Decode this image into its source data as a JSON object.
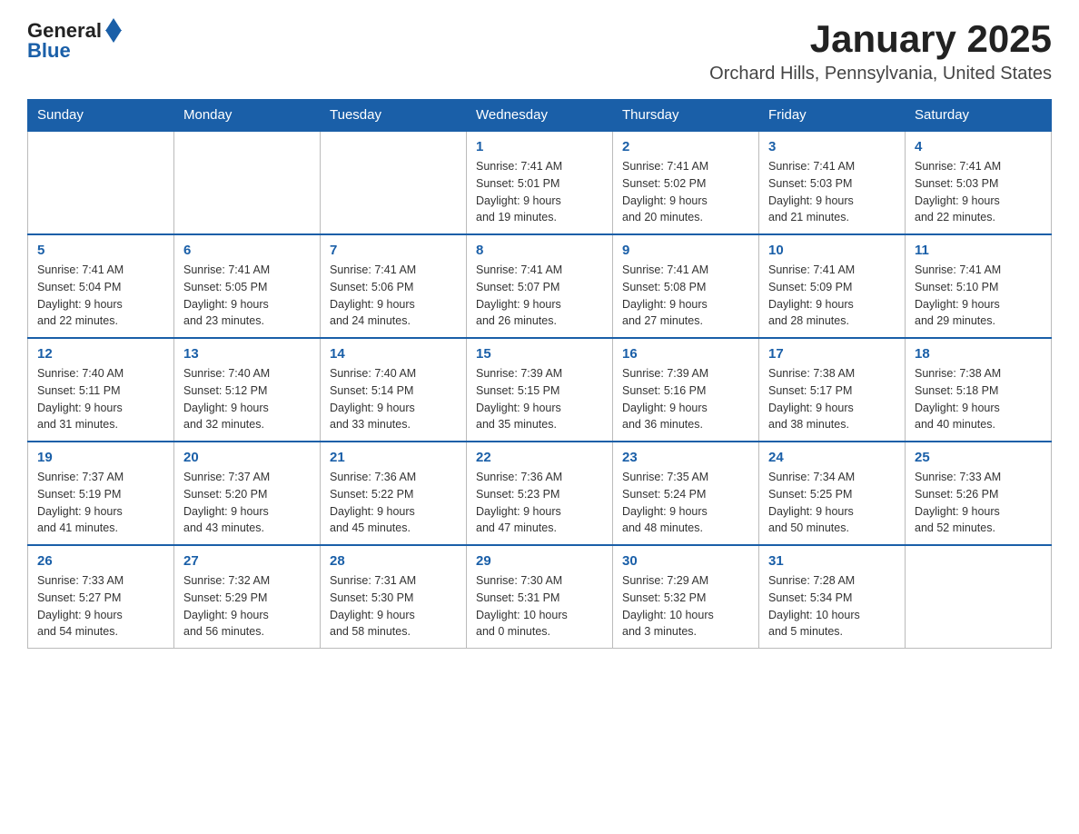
{
  "header": {
    "logo_general": "General",
    "logo_blue": "Blue",
    "month_title": "January 2025",
    "location": "Orchard Hills, Pennsylvania, United States"
  },
  "days_of_week": [
    "Sunday",
    "Monday",
    "Tuesday",
    "Wednesday",
    "Thursday",
    "Friday",
    "Saturday"
  ],
  "weeks": [
    {
      "days": [
        {
          "number": "",
          "info": ""
        },
        {
          "number": "",
          "info": ""
        },
        {
          "number": "",
          "info": ""
        },
        {
          "number": "1",
          "info": "Sunrise: 7:41 AM\nSunset: 5:01 PM\nDaylight: 9 hours\nand 19 minutes."
        },
        {
          "number": "2",
          "info": "Sunrise: 7:41 AM\nSunset: 5:02 PM\nDaylight: 9 hours\nand 20 minutes."
        },
        {
          "number": "3",
          "info": "Sunrise: 7:41 AM\nSunset: 5:03 PM\nDaylight: 9 hours\nand 21 minutes."
        },
        {
          "number": "4",
          "info": "Sunrise: 7:41 AM\nSunset: 5:03 PM\nDaylight: 9 hours\nand 22 minutes."
        }
      ]
    },
    {
      "days": [
        {
          "number": "5",
          "info": "Sunrise: 7:41 AM\nSunset: 5:04 PM\nDaylight: 9 hours\nand 22 minutes."
        },
        {
          "number": "6",
          "info": "Sunrise: 7:41 AM\nSunset: 5:05 PM\nDaylight: 9 hours\nand 23 minutes."
        },
        {
          "number": "7",
          "info": "Sunrise: 7:41 AM\nSunset: 5:06 PM\nDaylight: 9 hours\nand 24 minutes."
        },
        {
          "number": "8",
          "info": "Sunrise: 7:41 AM\nSunset: 5:07 PM\nDaylight: 9 hours\nand 26 minutes."
        },
        {
          "number": "9",
          "info": "Sunrise: 7:41 AM\nSunset: 5:08 PM\nDaylight: 9 hours\nand 27 minutes."
        },
        {
          "number": "10",
          "info": "Sunrise: 7:41 AM\nSunset: 5:09 PM\nDaylight: 9 hours\nand 28 minutes."
        },
        {
          "number": "11",
          "info": "Sunrise: 7:41 AM\nSunset: 5:10 PM\nDaylight: 9 hours\nand 29 minutes."
        }
      ]
    },
    {
      "days": [
        {
          "number": "12",
          "info": "Sunrise: 7:40 AM\nSunset: 5:11 PM\nDaylight: 9 hours\nand 31 minutes."
        },
        {
          "number": "13",
          "info": "Sunrise: 7:40 AM\nSunset: 5:12 PM\nDaylight: 9 hours\nand 32 minutes."
        },
        {
          "number": "14",
          "info": "Sunrise: 7:40 AM\nSunset: 5:14 PM\nDaylight: 9 hours\nand 33 minutes."
        },
        {
          "number": "15",
          "info": "Sunrise: 7:39 AM\nSunset: 5:15 PM\nDaylight: 9 hours\nand 35 minutes."
        },
        {
          "number": "16",
          "info": "Sunrise: 7:39 AM\nSunset: 5:16 PM\nDaylight: 9 hours\nand 36 minutes."
        },
        {
          "number": "17",
          "info": "Sunrise: 7:38 AM\nSunset: 5:17 PM\nDaylight: 9 hours\nand 38 minutes."
        },
        {
          "number": "18",
          "info": "Sunrise: 7:38 AM\nSunset: 5:18 PM\nDaylight: 9 hours\nand 40 minutes."
        }
      ]
    },
    {
      "days": [
        {
          "number": "19",
          "info": "Sunrise: 7:37 AM\nSunset: 5:19 PM\nDaylight: 9 hours\nand 41 minutes."
        },
        {
          "number": "20",
          "info": "Sunrise: 7:37 AM\nSunset: 5:20 PM\nDaylight: 9 hours\nand 43 minutes."
        },
        {
          "number": "21",
          "info": "Sunrise: 7:36 AM\nSunset: 5:22 PM\nDaylight: 9 hours\nand 45 minutes."
        },
        {
          "number": "22",
          "info": "Sunrise: 7:36 AM\nSunset: 5:23 PM\nDaylight: 9 hours\nand 47 minutes."
        },
        {
          "number": "23",
          "info": "Sunrise: 7:35 AM\nSunset: 5:24 PM\nDaylight: 9 hours\nand 48 minutes."
        },
        {
          "number": "24",
          "info": "Sunrise: 7:34 AM\nSunset: 5:25 PM\nDaylight: 9 hours\nand 50 minutes."
        },
        {
          "number": "25",
          "info": "Sunrise: 7:33 AM\nSunset: 5:26 PM\nDaylight: 9 hours\nand 52 minutes."
        }
      ]
    },
    {
      "days": [
        {
          "number": "26",
          "info": "Sunrise: 7:33 AM\nSunset: 5:27 PM\nDaylight: 9 hours\nand 54 minutes."
        },
        {
          "number": "27",
          "info": "Sunrise: 7:32 AM\nSunset: 5:29 PM\nDaylight: 9 hours\nand 56 minutes."
        },
        {
          "number": "28",
          "info": "Sunrise: 7:31 AM\nSunset: 5:30 PM\nDaylight: 9 hours\nand 58 minutes."
        },
        {
          "number": "29",
          "info": "Sunrise: 7:30 AM\nSunset: 5:31 PM\nDaylight: 10 hours\nand 0 minutes."
        },
        {
          "number": "30",
          "info": "Sunrise: 7:29 AM\nSunset: 5:32 PM\nDaylight: 10 hours\nand 3 minutes."
        },
        {
          "number": "31",
          "info": "Sunrise: 7:28 AM\nSunset: 5:34 PM\nDaylight: 10 hours\nand 5 minutes."
        },
        {
          "number": "",
          "info": ""
        }
      ]
    }
  ]
}
